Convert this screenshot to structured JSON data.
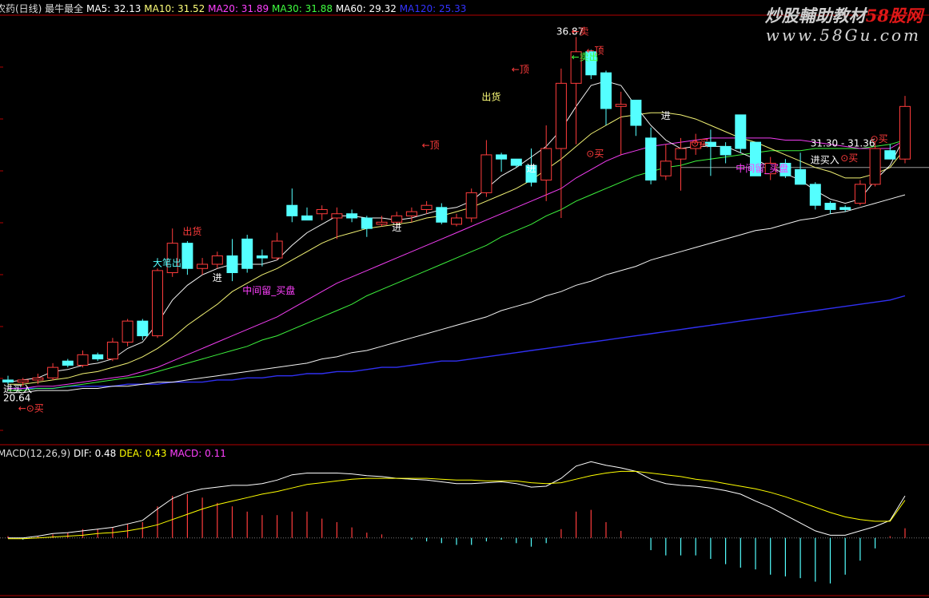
{
  "header": {
    "title": "农药(日线) 最牛最全",
    "ma": [
      {
        "label": "MA5: 32.13",
        "color": "#ffffff"
      },
      {
        "label": "MA10: 31.52",
        "color": "#ffff7a"
      },
      {
        "label": "MA20: 31.89",
        "color": "#ff40ff"
      },
      {
        "label": "MA30: 31.88",
        "color": "#40ff40"
      },
      {
        "label": "MA60: 29.32",
        "color": "#ffffff"
      },
      {
        "label": "MA120: 25.33",
        "color": "#3333ff"
      }
    ]
  },
  "watermark": {
    "line1_a": "炒股輔助教材",
    "line1_b": "58股网",
    "line2": "www.58Gu.com"
  },
  "macd_header": {
    "name": "MACD(12,26,9)",
    "items": [
      {
        "label": "DIF: 0.48",
        "color": "#ffffff"
      },
      {
        "label": "DEA: 0.43",
        "color": "#ffff00"
      },
      {
        "label": "MACD: 0.11",
        "color": "#ff40ff"
      }
    ]
  },
  "colors": {
    "up": "#ff3c3c",
    "down": "#54ffff",
    "ma5": "#ffffff",
    "ma10": "#ffff7a",
    "ma20": "#ff40ff",
    "ma30": "#40ff40",
    "ma60": "#ffffff",
    "ma120": "#3333ff",
    "border": "#b40000"
  },
  "chart_data": {
    "type": "candlestick",
    "ylim": [
      17.5,
      37.8
    ],
    "candles": [
      [
        20.5,
        20.7,
        20.3,
        20.4
      ],
      [
        20.4,
        20.6,
        20.2,
        20.5
      ],
      [
        20.5,
        20.8,
        20.3,
        20.6
      ],
      [
        20.6,
        21.3,
        20.5,
        21.1
      ],
      [
        21.4,
        21.5,
        21.1,
        21.2
      ],
      [
        21.2,
        21.9,
        21.1,
        21.7
      ],
      [
        21.7,
        21.8,
        21.4,
        21.5
      ],
      [
        21.5,
        22.5,
        21.4,
        22.3
      ],
      [
        22.3,
        23.4,
        22.1,
        23.3
      ],
      [
        23.3,
        23.4,
        22.4,
        22.6
      ],
      [
        22.6,
        25.8,
        22.5,
        25.7
      ],
      [
        25.6,
        27.7,
        25.4,
        27.0
      ],
      [
        27.0,
        27.1,
        25.5,
        25.8
      ],
      [
        25.8,
        26.3,
        25.5,
        26.0
      ],
      [
        26.0,
        26.6,
        25.8,
        26.4
      ],
      [
        26.4,
        27.2,
        25.2,
        25.6
      ],
      [
        27.2,
        27.4,
        25.6,
        25.8
      ],
      [
        26.4,
        26.7,
        25.9,
        26.3
      ],
      [
        26.3,
        27.5,
        26.2,
        27.1
      ],
      [
        28.8,
        29.6,
        28.0,
        28.3
      ],
      [
        28.3,
        28.7,
        28.1,
        28.1
      ],
      [
        28.4,
        28.8,
        28.1,
        28.6
      ],
      [
        28.2,
        28.7,
        27.2,
        28.4
      ],
      [
        28.4,
        28.6,
        28.0,
        28.2
      ],
      [
        28.2,
        28.3,
        27.3,
        27.7
      ],
      [
        27.9,
        28.3,
        27.8,
        28.0
      ],
      [
        28.0,
        28.5,
        27.8,
        28.3
      ],
      [
        28.3,
        28.7,
        28.0,
        28.5
      ],
      [
        28.6,
        29.0,
        28.4,
        28.8
      ],
      [
        28.7,
        28.9,
        27.9,
        28.0
      ],
      [
        27.9,
        28.4,
        27.8,
        28.2
      ],
      [
        28.2,
        29.6,
        28.0,
        29.4
      ],
      [
        29.4,
        31.9,
        29.2,
        31.2
      ],
      [
        31.2,
        31.3,
        30.4,
        31.0
      ],
      [
        31.0,
        31.0,
        30.6,
        30.7
      ],
      [
        30.7,
        31.5,
        29.7,
        29.9
      ],
      [
        30.0,
        32.6,
        29.0,
        31.5
      ],
      [
        31.5,
        35.3,
        28.2,
        34.6
      ],
      [
        34.6,
        36.8,
        31.7,
        36.1
      ],
      [
        36.1,
        36.2,
        34.8,
        35.0
      ],
      [
        35.1,
        35.2,
        32.6,
        33.4
      ],
      [
        33.5,
        34.2,
        31.2,
        33.6
      ],
      [
        33.8,
        33.8,
        32.1,
        32.6
      ],
      [
        32.0,
        32.5,
        29.8,
        30.0
      ],
      [
        30.2,
        31.7,
        30.0,
        30.9
      ],
      [
        31.0,
        32.0,
        29.5,
        31.5
      ],
      [
        31.5,
        32.2,
        31.2,
        31.8
      ],
      [
        31.8,
        32.4,
        30.2,
        31.6
      ],
      [
        31.6,
        31.8,
        30.8,
        31.2
      ],
      [
        33.1,
        33.1,
        31.3,
        31.5
      ],
      [
        31.8,
        31.8,
        30.2,
        30.2
      ],
      [
        30.3,
        31.1,
        30.0,
        30.8
      ],
      [
        30.8,
        31.0,
        30.1,
        30.2
      ],
      [
        30.5,
        31.3,
        29.8,
        29.8
      ],
      [
        29.8,
        29.9,
        28.6,
        28.8
      ],
      [
        28.9,
        29.0,
        28.4,
        28.6
      ],
      [
        28.7,
        28.8,
        28.5,
        28.6
      ],
      [
        28.9,
        30.0,
        28.8,
        29.8
      ],
      [
        29.8,
        31.8,
        29.7,
        31.5
      ],
      [
        31.4,
        31.7,
        31.0,
        31.0
      ],
      [
        31.0,
        34.0,
        30.8,
        33.5
      ]
    ],
    "ma5": [
      20.4,
      20.5,
      20.6,
      20.9,
      21.0,
      21.2,
      21.3,
      21.5,
      22.0,
      22.3,
      23.2,
      24.3,
      25.0,
      25.5,
      25.8,
      26.0,
      26.0,
      26.0,
      26.2,
      26.9,
      27.5,
      27.9,
      28.3,
      28.3,
      28.2,
      28.2,
      28.1,
      28.2,
      28.4,
      28.6,
      28.7,
      29.0,
      29.6,
      30.2,
      30.6,
      31.1,
      31.6,
      32.4,
      33.5,
      34.5,
      34.7,
      34.5,
      33.5,
      32.6,
      31.9,
      31.5,
      31.6,
      31.6,
      31.6,
      31.3,
      31.0,
      30.6,
      30.3,
      30.0,
      29.5,
      29.1,
      28.9,
      29.1,
      30.0,
      30.7,
      32.1
    ],
    "ma10": [
      20.3,
      20.3,
      20.4,
      20.5,
      20.6,
      20.8,
      20.9,
      21.1,
      21.3,
      21.6,
      22.0,
      22.5,
      23.1,
      23.6,
      24.1,
      24.7,
      25.1,
      25.5,
      25.8,
      26.2,
      26.6,
      27.0,
      27.3,
      27.5,
      27.7,
      27.8,
      27.9,
      28.0,
      28.2,
      28.3,
      28.5,
      28.7,
      29.0,
      29.3,
      29.6,
      30.0,
      30.5,
      31.0,
      31.6,
      32.2,
      32.6,
      33.0,
      33.1,
      33.2,
      33.2,
      33.1,
      32.9,
      32.6,
      32.3,
      32.0,
      31.8,
      31.5,
      31.2,
      30.9,
      30.6,
      30.4,
      30.1,
      30.1,
      30.3,
      30.6,
      31.5
    ],
    "ma20": [
      20.1,
      20.1,
      20.2,
      20.2,
      20.3,
      20.4,
      20.5,
      20.6,
      20.7,
      20.9,
      21.1,
      21.4,
      21.7,
      22.0,
      22.3,
      22.6,
      22.9,
      23.2,
      23.5,
      23.9,
      24.3,
      24.7,
      25.1,
      25.4,
      25.7,
      26.0,
      26.3,
      26.6,
      26.9,
      27.2,
      27.5,
      27.8,
      28.1,
      28.4,
      28.7,
      29.0,
      29.3,
      29.6,
      30.1,
      30.5,
      30.9,
      31.2,
      31.4,
      31.6,
      31.7,
      31.8,
      31.9,
      32.0,
      32.0,
      32.0,
      32.0,
      32.0,
      31.9,
      31.9,
      31.8,
      31.7,
      31.6,
      31.5,
      31.5,
      31.5,
      31.9
    ],
    "ma30": [
      20.0,
      20.0,
      20.1,
      20.1,
      20.2,
      20.3,
      20.4,
      20.5,
      20.6,
      20.7,
      20.9,
      21.1,
      21.3,
      21.5,
      21.7,
      21.9,
      22.1,
      22.4,
      22.6,
      22.9,
      23.2,
      23.5,
      23.8,
      24.1,
      24.5,
      24.8,
      25.1,
      25.4,
      25.7,
      26.0,
      26.3,
      26.6,
      26.9,
      27.3,
      27.6,
      27.9,
      28.3,
      28.6,
      29.0,
      29.3,
      29.6,
      29.9,
      30.2,
      30.4,
      30.6,
      30.7,
      30.9,
      31.0,
      31.1,
      31.2,
      31.3,
      31.4,
      31.4,
      31.4,
      31.5,
      31.5,
      31.5,
      31.5,
      31.6,
      31.7,
      31.9
    ],
    "ma60": [
      19.9,
      19.9,
      20.0,
      20.0,
      20.0,
      20.1,
      20.1,
      20.2,
      20.2,
      20.3,
      20.4,
      20.4,
      20.5,
      20.6,
      20.7,
      20.8,
      20.9,
      21.0,
      21.1,
      21.2,
      21.3,
      21.5,
      21.6,
      21.8,
      21.9,
      22.1,
      22.3,
      22.5,
      22.7,
      22.9,
      23.1,
      23.3,
      23.5,
      23.8,
      24.0,
      24.2,
      24.5,
      24.7,
      25.0,
      25.2,
      25.5,
      25.7,
      25.9,
      26.2,
      26.4,
      26.6,
      26.8,
      27.0,
      27.2,
      27.4,
      27.6,
      27.7,
      27.9,
      28.1,
      28.2,
      28.4,
      28.5,
      28.7,
      28.9,
      29.1,
      29.3
    ],
    "ma120": [
      20.1,
      20.1,
      20.1,
      20.1,
      20.2,
      20.2,
      20.2,
      20.2,
      20.3,
      20.3,
      20.3,
      20.4,
      20.4,
      20.4,
      20.5,
      20.5,
      20.6,
      20.6,
      20.7,
      20.7,
      20.8,
      20.8,
      20.9,
      20.9,
      21.0,
      21.1,
      21.1,
      21.2,
      21.3,
      21.4,
      21.4,
      21.5,
      21.6,
      21.7,
      21.8,
      21.9,
      22.0,
      22.1,
      22.2,
      22.3,
      22.4,
      22.5,
      22.6,
      22.7,
      22.8,
      22.9,
      23.0,
      23.1,
      23.2,
      23.3,
      23.4,
      23.5,
      23.6,
      23.7,
      23.8,
      23.9,
      24.0,
      24.1,
      24.2,
      24.3,
      24.5
    ],
    "gray_line": 30.6,
    "macd": {
      "ylim": [
        -0.65,
        0.9
      ],
      "dif": [
        0.0,
        0.0,
        0.02,
        0.05,
        0.06,
        0.08,
        0.1,
        0.12,
        0.16,
        0.2,
        0.33,
        0.45,
        0.52,
        0.56,
        0.58,
        0.6,
        0.6,
        0.62,
        0.66,
        0.72,
        0.74,
        0.74,
        0.74,
        0.73,
        0.71,
        0.7,
        0.68,
        0.67,
        0.66,
        0.64,
        0.62,
        0.62,
        0.63,
        0.64,
        0.62,
        0.58,
        0.59,
        0.68,
        0.82,
        0.87,
        0.83,
        0.8,
        0.76,
        0.67,
        0.62,
        0.6,
        0.59,
        0.57,
        0.54,
        0.5,
        0.42,
        0.35,
        0.26,
        0.17,
        0.08,
        0.03,
        0.03,
        0.08,
        0.13,
        0.2,
        0.48
      ],
      "dea": [
        -0.01,
        -0.01,
        0.0,
        0.01,
        0.02,
        0.03,
        0.05,
        0.06,
        0.08,
        0.11,
        0.15,
        0.21,
        0.27,
        0.33,
        0.38,
        0.42,
        0.46,
        0.5,
        0.53,
        0.57,
        0.61,
        0.63,
        0.65,
        0.67,
        0.68,
        0.68,
        0.68,
        0.68,
        0.68,
        0.67,
        0.66,
        0.66,
        0.65,
        0.65,
        0.65,
        0.63,
        0.62,
        0.63,
        0.67,
        0.71,
        0.74,
        0.76,
        0.76,
        0.74,
        0.72,
        0.7,
        0.67,
        0.65,
        0.62,
        0.59,
        0.56,
        0.52,
        0.47,
        0.41,
        0.35,
        0.29,
        0.24,
        0.21,
        0.19,
        0.19,
        0.43
      ],
      "hist": [
        0.02,
        -0.02,
        0.02,
        0.04,
        0.06,
        0.1,
        0.1,
        0.12,
        0.16,
        0.18,
        0.36,
        0.48,
        0.5,
        0.46,
        0.4,
        0.36,
        0.3,
        0.26,
        0.26,
        0.3,
        0.3,
        0.22,
        0.18,
        0.12,
        0.06,
        0.04,
        0.0,
        -0.02,
        -0.04,
        -0.06,
        -0.08,
        -0.08,
        -0.04,
        -0.02,
        -0.06,
        -0.1,
        -0.06,
        0.1,
        0.3,
        0.32,
        0.18,
        0.08,
        0.0,
        -0.14,
        -0.2,
        -0.2,
        -0.2,
        -0.24,
        -0.3,
        -0.34,
        -0.36,
        -0.42,
        -0.44,
        -0.46,
        -0.5,
        -0.52,
        -0.42,
        -0.26,
        -0.12,
        0.02,
        0.11
      ]
    },
    "annotations": [
      {
        "text": "出货",
        "i": 12,
        "y": 27.4,
        "color": "#ff3c3c"
      },
      {
        "text": "大笔出",
        "i": 10,
        "y": 25.9,
        "color": "#54ffff"
      },
      {
        "text": "进",
        "i": 14,
        "y": 25.2,
        "color": "#ffffff"
      },
      {
        "text": "中间留_买盘",
        "i": 16,
        "y": 24.6,
        "color": "#ff40ff"
      },
      {
        "text": "进",
        "i": 26,
        "y": 27.6,
        "color": "#ffffff"
      },
      {
        "text": "←顶",
        "i": 28,
        "y": 31.5,
        "color": "#ff3c3c"
      },
      {
        "text": "出货",
        "i": 32,
        "y": 33.8,
        "color": "#ffff7a"
      },
      {
        "text": "←顶",
        "i": 34,
        "y": 35.1,
        "color": "#ff3c3c"
      },
      {
        "text": "进",
        "i": 35,
        "y": 30.4,
        "color": "#ffffff"
      },
      {
        "text": "36.87",
        "i": 37,
        "y": 36.9,
        "color": "#ffffff"
      },
      {
        "text": "←卖",
        "i": 38,
        "y": 36.9,
        "color": "#ff3c3c"
      },
      {
        "text": "←顶",
        "i": 39,
        "y": 36.0,
        "color": "#ff3c3c"
      },
      {
        "text": "←卖出",
        "i": 38,
        "y": 35.7,
        "color": "#40ff40"
      },
      {
        "text": "⊙买",
        "i": 39,
        "y": 31.1,
        "color": "#ff3c3c"
      },
      {
        "text": "进",
        "i": 44,
        "y": 32.9,
        "color": "#ffffff"
      },
      {
        "text": "⊙买",
        "i": 46,
        "y": 31.6,
        "color": "#ff3c3c"
      },
      {
        "text": "中间留_买盘",
        "i": 49,
        "y": 30.4,
        "color": "#ff40ff"
      },
      {
        "text": "31.30 - 31.36",
        "i": 54,
        "y": 31.6,
        "color": "#ffffff"
      },
      {
        "text": "进买入",
        "i": 54,
        "y": 30.8,
        "color": "#ffffff"
      },
      {
        "text": "⊙买",
        "i": 56,
        "y": 30.9,
        "color": "#ff3c3c"
      },
      {
        "text": "⊙买",
        "i": 58,
        "y": 31.8,
        "color": "#ff3c3c"
      },
      {
        "text": "进买入",
        "i": 0,
        "y": 19.9,
        "color": "#ffffff"
      },
      {
        "text": "20.64",
        "i": 0,
        "y": 19.5,
        "color": "#ffffff"
      },
      {
        "text": "←⊙买",
        "i": 1,
        "y": 19.0,
        "color": "#ff3c3c"
      }
    ]
  }
}
